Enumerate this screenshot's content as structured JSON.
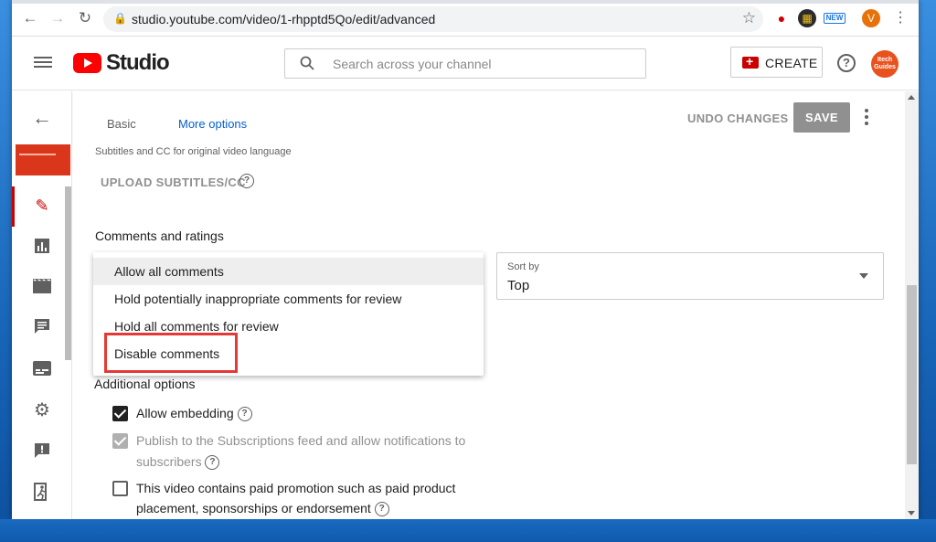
{
  "browser": {
    "url": "studio.youtube.com/video/1-rhpptd5Qo/edit/advanced",
    "avatar_letter": "V",
    "ext_badge": "NEW"
  },
  "header": {
    "logo_text": "Studio",
    "search_placeholder": "Search across your channel",
    "create_label": "CREATE",
    "avatar_text": "Itech Guides"
  },
  "toolbar": {
    "tabs": [
      "Basic",
      "More options"
    ],
    "active_tab": "More options",
    "undo_label": "UNDO CHANGES",
    "save_label": "SAVE"
  },
  "subtitles": {
    "caption": "Subtitles and CC for original video language",
    "upload_label": "UPLOAD SUBTITLES/CC"
  },
  "comments": {
    "title": "Comments and ratings",
    "options": [
      "Allow all comments",
      "Hold potentially inappropriate comments for review",
      "Hold all comments for review",
      "Disable comments"
    ],
    "selected": "Allow all comments",
    "highlighted": "Disable comments",
    "sort_caption": "Sort by",
    "sort_value": "Top"
  },
  "additional": {
    "title": "Additional options",
    "embedding": "Allow embedding",
    "publish_line1": "Publish to the Subscriptions feed and allow notifications to",
    "publish_line2": "subscribers",
    "promo_line1": "This video contains paid promotion such as paid product",
    "promo_line2": "placement, sponsorships or endorsement"
  },
  "colors": {
    "accent": "#065fd4",
    "brand_red": "#ff0000",
    "highlight_box": "#e53935"
  }
}
